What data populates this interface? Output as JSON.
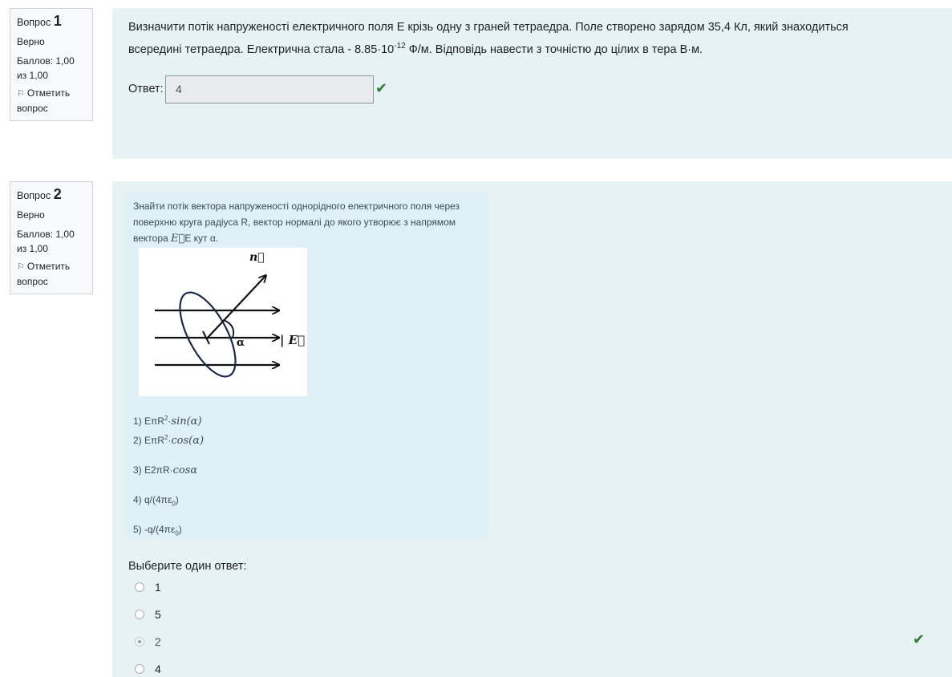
{
  "questions": [
    {
      "label": "Вопрос",
      "number": "1",
      "state": "Верно",
      "grade": "Баллов: 1,00 из 1,00",
      "flag": "Отметить вопрос",
      "text_part1": "Визначити потік напруженості електричного поля Е крізь одну з граней тетраедра. Поле створено зарядом 35,4 Кл, який знаходиться всередині тетраедра. Електрична стала - 8.85·10",
      "text_sup": "-12",
      "text_part2": " Ф/м. Відповідь навести з точністю до цілих в тера В·м.",
      "answer_label": "Ответ:",
      "answer_value": "4"
    },
    {
      "label": "Вопрос",
      "number": "2",
      "state": "Верно",
      "grade": "Баллов: 1,00 из 1,00",
      "flag": "Отметить вопрос",
      "text_part1": "Знайти потік вектора напруженості однорідного електричного поля через поверхню круга радіуса R, вектор нормалі до якого утворює з напрямом вектора ",
      "text_vec": "E⃗",
      "text_part2": "E кут α.",
      "figure": {
        "n_label": "n⃗",
        "alpha_label": "α",
        "e_label": "| E⃗"
      },
      "options": [
        {
          "prefix": "1) EπR",
          "sup": "2",
          "dot": "·",
          "math": "sin(α)"
        },
        {
          "prefix": "2) EπR",
          "sup": "2",
          "dot": "·",
          "math": "cos(α)"
        },
        {
          "prefix": "3) E2πR·",
          "math": "cosα"
        },
        {
          "prefix": "4) q/(4πε",
          "sub": "0",
          "suffix": ")"
        },
        {
          "prefix": "5) -q/(4πε",
          "sub": "0",
          "suffix": ")"
        }
      ],
      "select_label": "Выберите один ответ:",
      "choices": [
        {
          "label": "1",
          "checked": false
        },
        {
          "label": "5",
          "checked": false
        },
        {
          "label": "2",
          "checked": true
        },
        {
          "label": "4",
          "checked": false
        }
      ]
    }
  ],
  "icons": {
    "check": "check-icon",
    "flag": "flag-icon"
  },
  "colors": {
    "correct": "#2e7d32",
    "content_bg": "#e6f2f4",
    "card_bg": "#dff0f6"
  }
}
